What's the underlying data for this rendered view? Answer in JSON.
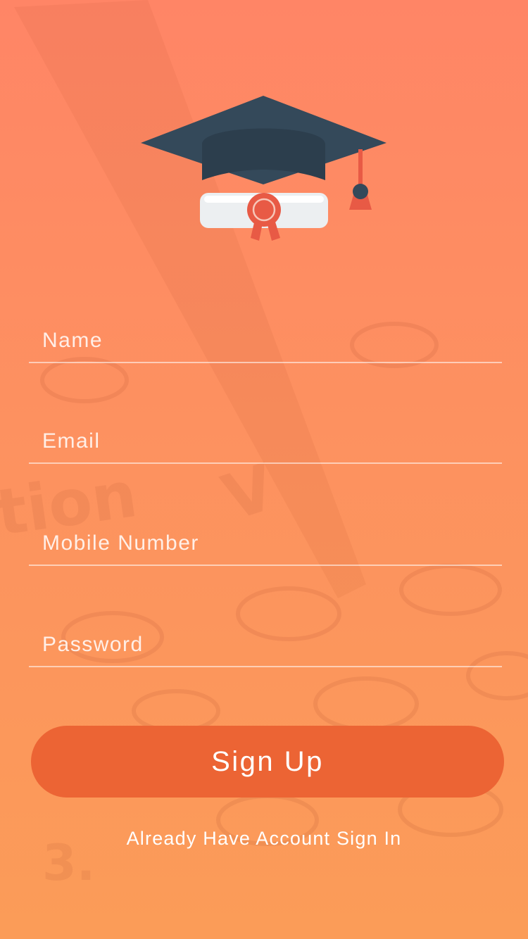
{
  "form": {
    "name_placeholder": "Name",
    "email_placeholder": "Email",
    "mobile_placeholder": "Mobile Number",
    "password_placeholder": "Password"
  },
  "actions": {
    "signup_label": "Sign Up",
    "signin_link": "Already Have Account Sign In"
  },
  "logo": {
    "icon": "graduation-cap-diploma-icon"
  },
  "colors": {
    "background_top": "#ff8566",
    "background_bottom": "#fb9c58",
    "button": "#ec6434",
    "cap": "#34495a",
    "ribbon": "#e85a45"
  }
}
